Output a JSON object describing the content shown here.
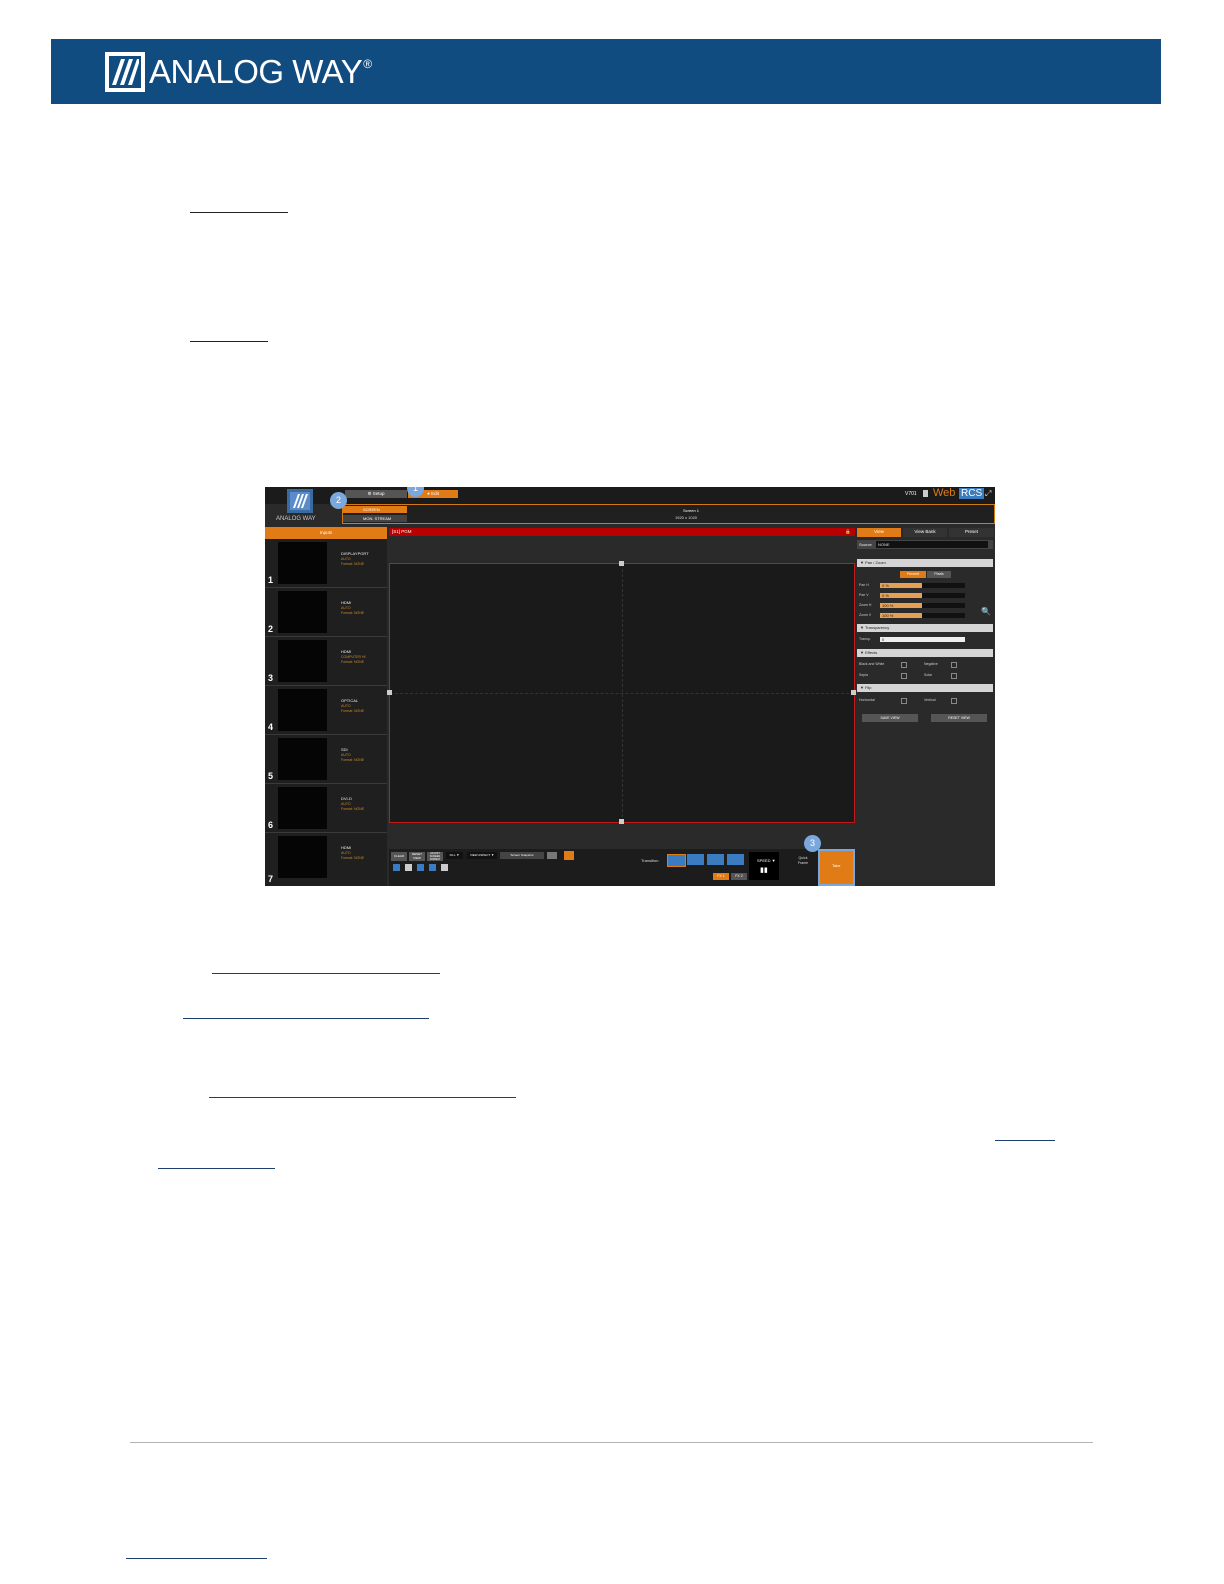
{
  "header": {
    "brand": "ANALOG WAY",
    "brand_mark": "®",
    "bg_color": "#114c80"
  },
  "screenshot": {
    "top_tabs": {
      "setup": "Setup",
      "edit": "Edit"
    },
    "logo_caption": "ANALOG WAY",
    "screen_selector": {
      "screen": "SCREEN",
      "aux": "MON. STREAM"
    },
    "screen_info": {
      "name": "Screen 1",
      "resolution": "1920 x 1020"
    },
    "version": "V701",
    "brand_web": "Web",
    "brand_rcs": "RCS",
    "inputs_header": "Inputs",
    "inputs": [
      {
        "num": "1",
        "name": "DISPLAYPORT",
        "l1": "AUTO",
        "l2": "Format: NONE"
      },
      {
        "num": "2",
        "name": "HDMI",
        "l1": "AUTO",
        "l2": "Format: NONE"
      },
      {
        "num": "3",
        "name": "HDMI",
        "l1": "COMPUTER HI",
        "l2": "Format: NONE"
      },
      {
        "num": "4",
        "name": "OPTICAL",
        "l1": "AUTO",
        "l2": "Format: NONE"
      },
      {
        "num": "5",
        "name": "SDI",
        "l1": "AUTO",
        "l2": "Format: NONE"
      },
      {
        "num": "6",
        "name": "DVI-D",
        "l1": "AUTO",
        "l2": "Format: NONE"
      },
      {
        "num": "7",
        "name": "HDMI",
        "l1": "AUTO",
        "l2": "Format: NONE"
      }
    ],
    "program_label": "[S1] PGM",
    "right_tabs": {
      "view": "View",
      "view_bank": "View Bank",
      "preset": "Preset"
    },
    "source_label": "Source",
    "source_value": "NONE",
    "pan_zoom": {
      "title": "▼ Pan / Zoom",
      "percent": "Percent",
      "pixels": "Pixels",
      "rows": [
        {
          "label": "Pan H",
          "value": "0 %"
        },
        {
          "label": "Pan V",
          "value": "0 %"
        },
        {
          "label": "Zoom H",
          "value": "100 %"
        },
        {
          "label": "Zoom V",
          "value": "100 %"
        }
      ]
    },
    "transparency": {
      "title": "▼ Transparency",
      "label": "Transp.",
      "value": "0"
    },
    "effects": {
      "title": "▼ Effects",
      "items": [
        "Black and White",
        "Negative",
        "Sepia",
        "Solar"
      ]
    },
    "flip": {
      "title": "▼ Flip",
      "items": [
        "Horizontal",
        "Vertical"
      ]
    },
    "save_view": "SAVE VIEW",
    "reset_view": "RESET VIEW",
    "bottom": {
      "b1": "CLEAR",
      "b2": "RESET VIEW",
      "b3": "ADJUST SCREEN FORMAT",
      "fill": "FILL ▼",
      "view_aspect": "VIEW ASPECT ▼",
      "snapshot": "Screen Snapshot",
      "transition": "Transition",
      "quick_frame": "Quick Frame",
      "fx1": "FX 1",
      "fx2": "FX 2",
      "speed": "SPEED ▼",
      "take": "Take"
    },
    "badges": [
      "1",
      "2",
      "3"
    ]
  }
}
